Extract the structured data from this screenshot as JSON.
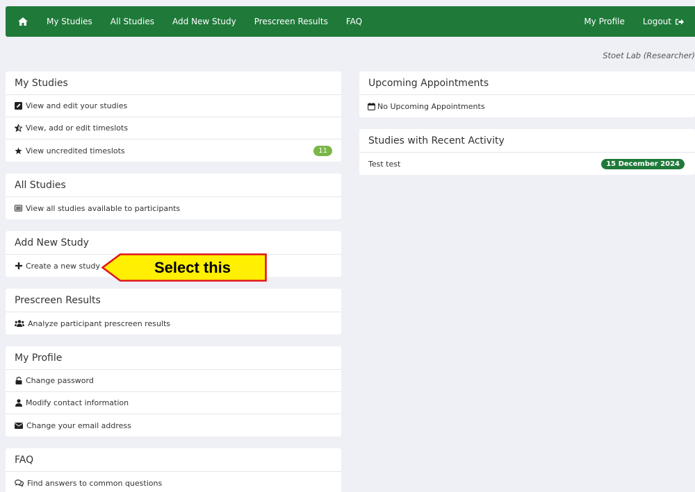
{
  "navbar": {
    "left": [
      "My Studies",
      "All Studies",
      "Add New Study",
      "Prescreen Results",
      "FAQ"
    ],
    "right": [
      "My Profile",
      "Logout"
    ],
    "color": "#1f7a3a"
  },
  "role_line": "Stoet Lab (Researcher)",
  "panels": {
    "my_studies": {
      "title": "My Studies",
      "items": [
        "View and edit your studies",
        "View, add or edit timeslots",
        "View uncredited timeslots"
      ],
      "badge": "11"
    },
    "all_studies": {
      "title": "All Studies",
      "items": [
        "View all studies available to participants"
      ]
    },
    "add_new_study": {
      "title": "Add New Study",
      "items": [
        "Create a new study"
      ]
    },
    "prescreen": {
      "title": "Prescreen Results",
      "items": [
        "Analyze participant prescreen results"
      ]
    },
    "my_profile": {
      "title": "My Profile",
      "items": [
        "Change password",
        "Modify contact information",
        "Change your email address"
      ]
    },
    "faq": {
      "title": "FAQ",
      "items": [
        "Find answers to common questions"
      ]
    },
    "upcoming": {
      "title": "Upcoming Appointments",
      "items": [
        "No Upcoming Appointments"
      ]
    },
    "recent": {
      "title": "Studies with Recent Activity",
      "items": [
        "Test test"
      ],
      "date": "15 December 2024"
    }
  },
  "callout": {
    "text": "Select this",
    "fill": "#ffef00",
    "border": "#e0141e"
  },
  "icons": {
    "home": "home-icon",
    "logout": "sign-out-icon",
    "edit": "edit-icon",
    "star_half": "star-half-icon",
    "star": "star-icon",
    "list": "list-icon",
    "plus": "plus-icon",
    "users": "users-icon",
    "unlock": "unlock-icon",
    "user": "user-icon",
    "envelope": "envelope-icon",
    "comments": "comments-icon",
    "calendar": "calendar-icon"
  }
}
